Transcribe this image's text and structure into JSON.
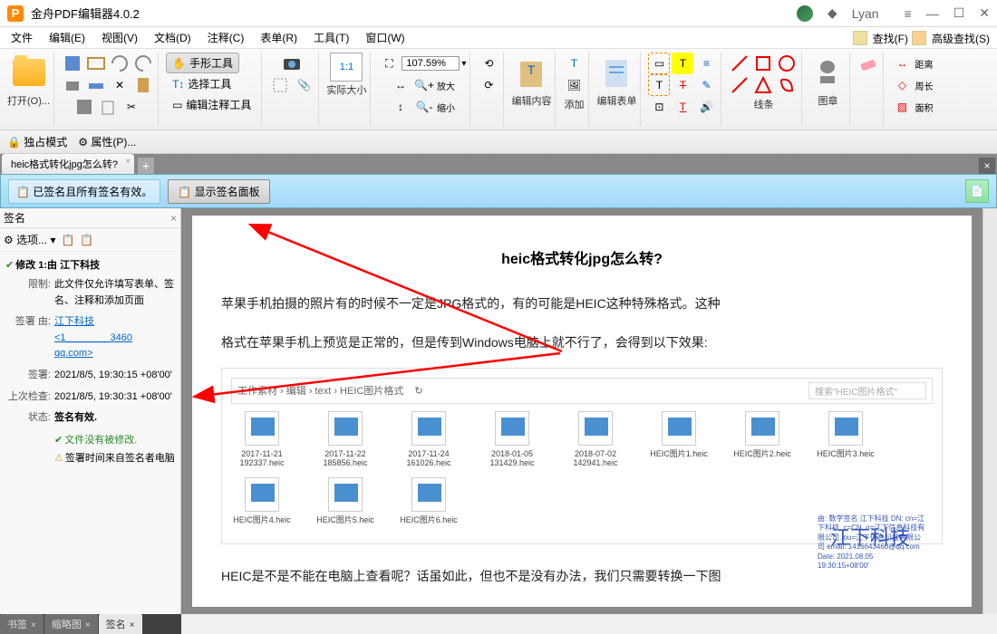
{
  "app": {
    "title": "金舟PDF编辑器4.0.2",
    "user": "Lyan"
  },
  "menu": {
    "file": "文件",
    "edit": "编辑(E)",
    "view": "视图(V)",
    "doc": "文档(D)",
    "comment": "注释(C)",
    "form": "表单(R)",
    "tool": "工具(T)",
    "window": "窗口(W)"
  },
  "search": {
    "find": "查找(F)",
    "advfind": "高级查找(S)"
  },
  "tb": {
    "open": "打开(O)...",
    "handtool": "手形工具",
    "selecttool": "选择工具",
    "edittool": "编辑注释工具",
    "actual": "实际大小",
    "zoomin": "放大",
    "zoomout": "缩小",
    "zoompct": "107.59%",
    "editcontent": "编辑内容",
    "add": "添加",
    "editform": "编辑表单",
    "lines": "线条",
    "stamp": "图章",
    "distance": "距离",
    "perimeter": "周长",
    "area": "面积"
  },
  "sub": {
    "exclusive": "独占模式",
    "props": "属性(P)..."
  },
  "tab": {
    "name": "heic格式转化jpg怎么转?"
  },
  "sig": {
    "bar_msg": "已签名且所有签名有效。",
    "bar_btn": "显示签名面板",
    "panel": "签名",
    "options": "选项...",
    "revline": "修改 1:由 江下科技",
    "limit_k": "限制:",
    "limit_v": "此文件仅允许填写表单、签名、注释和添加页面",
    "signby_k": "签署 由:",
    "signby_v1": "江下科技",
    "signby_v2": "<1________3460",
    "signby_v3": "qq.com>",
    "date_k": "签署:",
    "date_v": "2021/8/5, 19:30:15 +08'00'",
    "check_k": "上次检查:",
    "check_v": "2021/8/5, 19:30:31 +08'00'",
    "status_k": "状态:",
    "status_v": "签名有效.",
    "mod": "文件没有被修改.",
    "time": "签署时间来自签名者电脑"
  },
  "doc": {
    "h": "heic格式转化jpg怎么转?",
    "p1": "苹果手机拍摄的照片有的时候不一定是JPG格式的，有的可能是HEIC这种特殊格式。这种",
    "p2": "格式在苹果手机上预览是正常的，但是传到Windows电脑上就不行了，会得到以下效果:",
    "p3": "HEIC是不是不能在电脑上查看呢？话虽如此，但也不是没有办法，我们只需要转换一下图",
    "crumb": "工作素材 › 编辑 › text › HEIC图片格式",
    "searchph": "搜索\"HEIC图片格式\"",
    "files": [
      {
        "n1": "2017-11-21",
        "n2": "192337.heic"
      },
      {
        "n1": "2017-11-22",
        "n2": "185856.heic"
      },
      {
        "n1": "2017-11-24",
        "n2": "161026.heic"
      },
      {
        "n1": "2018-01-05",
        "n2": "131429.heic"
      },
      {
        "n1": "2018-07-02",
        "n2": "142941.heic"
      },
      {
        "n1": "HEIC图片1.heic",
        "n2": ""
      },
      {
        "n1": "HEIC图片2.heic",
        "n2": ""
      },
      {
        "n1": "HEIC图片3.heic",
        "n2": ""
      }
    ],
    "files2": [
      {
        "n1": "HEIC图片4.heic",
        "n2": ""
      },
      {
        "n1": "HEIC图片5.heic",
        "n2": ""
      },
      {
        "n1": "HEIC图片6.heic",
        "n2": ""
      }
    ],
    "stamp": "江下科技",
    "stampinfo": "由: 数字签名 江下科技\nDN: cn=江下科技, c=CN, o=江下信息科技有限公司, ou=江下信息科技有限公司\nemail: 1416643460@qq.com\nDate: 2021.08.05 19:30:15+08'00'"
  },
  "btabs": {
    "bookmark": "书签",
    "thumb": "缩略图",
    "sig": "签名"
  }
}
